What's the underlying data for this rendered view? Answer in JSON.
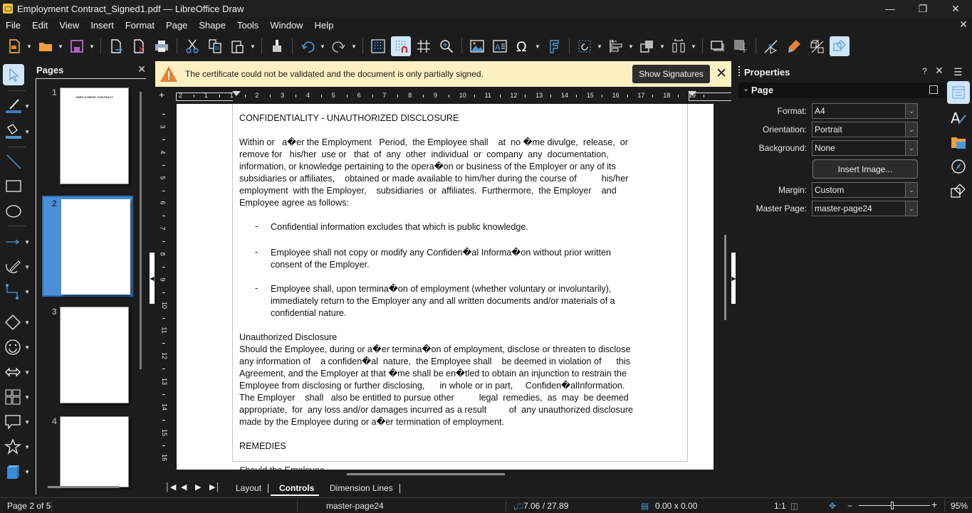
{
  "window": {
    "title": "Employment Contract_Signed1.pdf — LibreOffice Draw",
    "controls": [
      "minimize",
      "restore",
      "close"
    ]
  },
  "menubar": {
    "items": [
      "File",
      "Edit",
      "View",
      "Insert",
      "Format",
      "Page",
      "Shape",
      "Tools",
      "Window",
      "Help"
    ]
  },
  "toolbar": {
    "items": [
      "new-document",
      "open",
      "save",
      "export",
      "export-pdf",
      "print",
      "cut",
      "copy",
      "paste",
      "clone-formatting",
      "undo",
      "redo",
      "display-grid",
      "snap-to-grid",
      "helplines-while-moving",
      "zoom-and-pan",
      "insert-image",
      "insert-text-box",
      "insert-special-character",
      "fontwork",
      "transformations",
      "align-objects",
      "arrange",
      "distribute",
      "shadow",
      "crop-image",
      "points",
      "glue-points",
      "toggle-extrusion",
      "show-draw-functions"
    ],
    "active": [
      "snap-to-grid",
      "show-draw-functions"
    ]
  },
  "infobar": {
    "message": "The certificate could not be validated and the document is only partially signed.",
    "button_label": "Show Signatures",
    "colors": {
      "background": "#fdf0c2",
      "icon": "#e8823a"
    }
  },
  "pages_panel": {
    "title": "Pages",
    "pages": [
      {
        "number": "1",
        "heading": "EMPLOYMENT CONTRACT"
      },
      {
        "number": "2",
        "selected": true
      },
      {
        "number": "3"
      },
      {
        "number": "4"
      }
    ]
  },
  "rulers": {
    "horizontal_labels": [
      "2",
      "1",
      "1",
      "2",
      "3",
      "4",
      "5",
      "6",
      "7",
      "8",
      "9",
      "10",
      "11",
      "12",
      "13",
      "14",
      "15",
      "16",
      "17",
      "18",
      "19"
    ],
    "vertical_labels": [
      "3",
      "4",
      "5",
      "6",
      "7",
      "8",
      "9",
      "10",
      "11",
      "12",
      "13",
      "14",
      "15",
      "16"
    ]
  },
  "document": {
    "heading1": "CONFIDENTIALITY - UNAUTHORIZED DISCLOSURE",
    "para1": [
      "Within or   a�er the Employment   Period,  the Employee shall    at  no �me divulge,  release,  or",
      "remove for   his/her  use or   that  of  any  other  individual  or  company  any  documentation,",
      "information, or knowledge pertaining to the opera�on or business of the Employer or any of its",
      "subsidiaries or affiliates,    obtained or made available to him/her during the course of          his/her",
      "employment  with the Employer,    subsidiaries  or  affiliates.  Furthermore,  the Employer    and",
      "Employee agree as follows:"
    ],
    "bullets": [
      [
        "Confidential information excludes that which is public knowledge."
      ],
      [
        "Employee shall not copy or modify any Confiden�al Informa�on without prior written",
        "consent of the Employer."
      ],
      [
        "Employee shall, upon termina�on of employment (whether voluntary or involuntarily),",
        "immediately return to the Employer any and all written documents and/or materials of a",
        "confidential nature."
      ]
    ],
    "bullet_marker": "-",
    "heading2": "Unauthorized Disclosure ",
    "para2": [
      "Should the Employee, during or a�er termina�on of employment, disclose or threaten to disclose",
      "any information of    a confiden�al  nature,  the Employee shall    be deemed in violation of      this",
      "Agreement, and the Employer at that �me shall be en�tled to obtain an injunction to restrain the",
      "Employee from disclosing or further disclosing,      in whole or in part,     Confiden�alInformation.",
      "The Employer    shall   also be entitled to pursue other          legal  remedies,  as  may  be deemed",
      "appropriate,  for  any loss and/or damages incurred as a result         of  any unauthorized disclosure",
      "made by the Employee during or a�er termination of employment."
    ],
    "heading3": "REMEDIES",
    "cutoff_line": "Should the Employee  ..."
  },
  "layer_tabs": {
    "tabs": [
      "Layout",
      "Controls",
      "Dimension Lines"
    ],
    "active": "Controls"
  },
  "sidebar": {
    "title": "Properties",
    "help": "?",
    "section": "Page",
    "fields": {
      "format_label": "Format:",
      "format_value": "A4",
      "orientation_label": "Orientation:",
      "orientation_value": "Portrait",
      "background_label": "Background:",
      "background_value": "None",
      "insert_image_label": "Insert Image...",
      "margin_label": "Margin:",
      "margin_value": "Custom",
      "master_page_label": "Master Page:",
      "master_page_value": "master-page24"
    },
    "tabs": [
      "properties",
      "styles",
      "gallery",
      "navigator",
      "shapes"
    ],
    "active_tab": "properties"
  },
  "statusbar": {
    "page": "Page 2 of 5",
    "master": "master-page24",
    "position": "7.06 / 27.89",
    "size": "0.00 x 0.00",
    "scale": "1:1",
    "zoom_percent": "95%",
    "zoom_value": 95
  }
}
